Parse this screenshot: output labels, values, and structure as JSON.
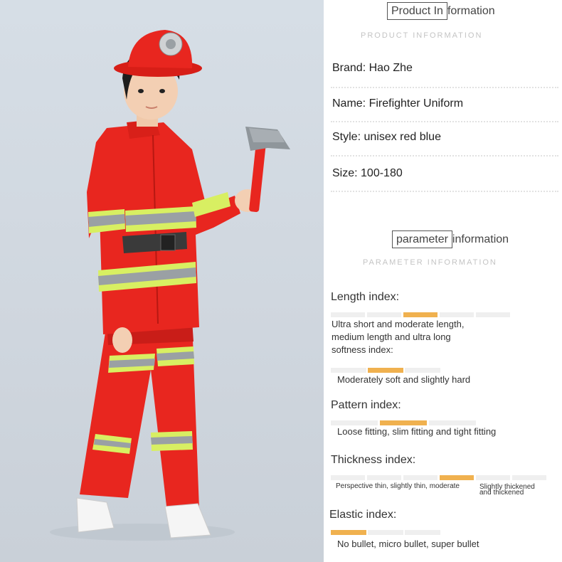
{
  "product_info": {
    "heading_boxed": "Product In",
    "heading_rest": "formation",
    "subheading": "PRODUCT INFORMATION",
    "lines": [
      "Brand: Hao Zhe",
      "Name: Firefighter Uniform",
      "Style: unisex red blue",
      "Size: 100-180"
    ]
  },
  "parameter_info": {
    "heading_boxed": "parameter",
    "heading_rest": "information",
    "subheading": "PARAMETER INFORMATION"
  },
  "indexes": {
    "length": {
      "label": "Length index:",
      "active_segment": 3,
      "segments": 5,
      "desc_line1": "Ultra short and moderate length,",
      "desc_line2": "medium length and ultra long",
      "desc_line3": "softness index:"
    },
    "softness": {
      "active_segment": 2,
      "segments": 3,
      "desc": "Moderately soft and slightly hard"
    },
    "pattern": {
      "label": "Pattern index:",
      "active_segment": 2,
      "segments": 3,
      "desc": "Loose fitting, slim fitting and tight fitting"
    },
    "thickness": {
      "label": "Thickness index:",
      "active_segment": 4,
      "segments": 6,
      "desc_left": "Perspective thin, slightly thin, moderate",
      "desc_right_1": "Slightly thickened",
      "desc_right_2": "and thickened"
    },
    "elastic": {
      "label": "Elastic index:",
      "active_segment": 1,
      "segments": 3,
      "desc": "No bullet, micro bullet, super bullet"
    }
  },
  "colors": {
    "accent_bar": "#f0b14f",
    "inactive_bar": "#efefef",
    "uniform_red": "#e8261f",
    "reflective_stripe": "#d8ef62"
  }
}
